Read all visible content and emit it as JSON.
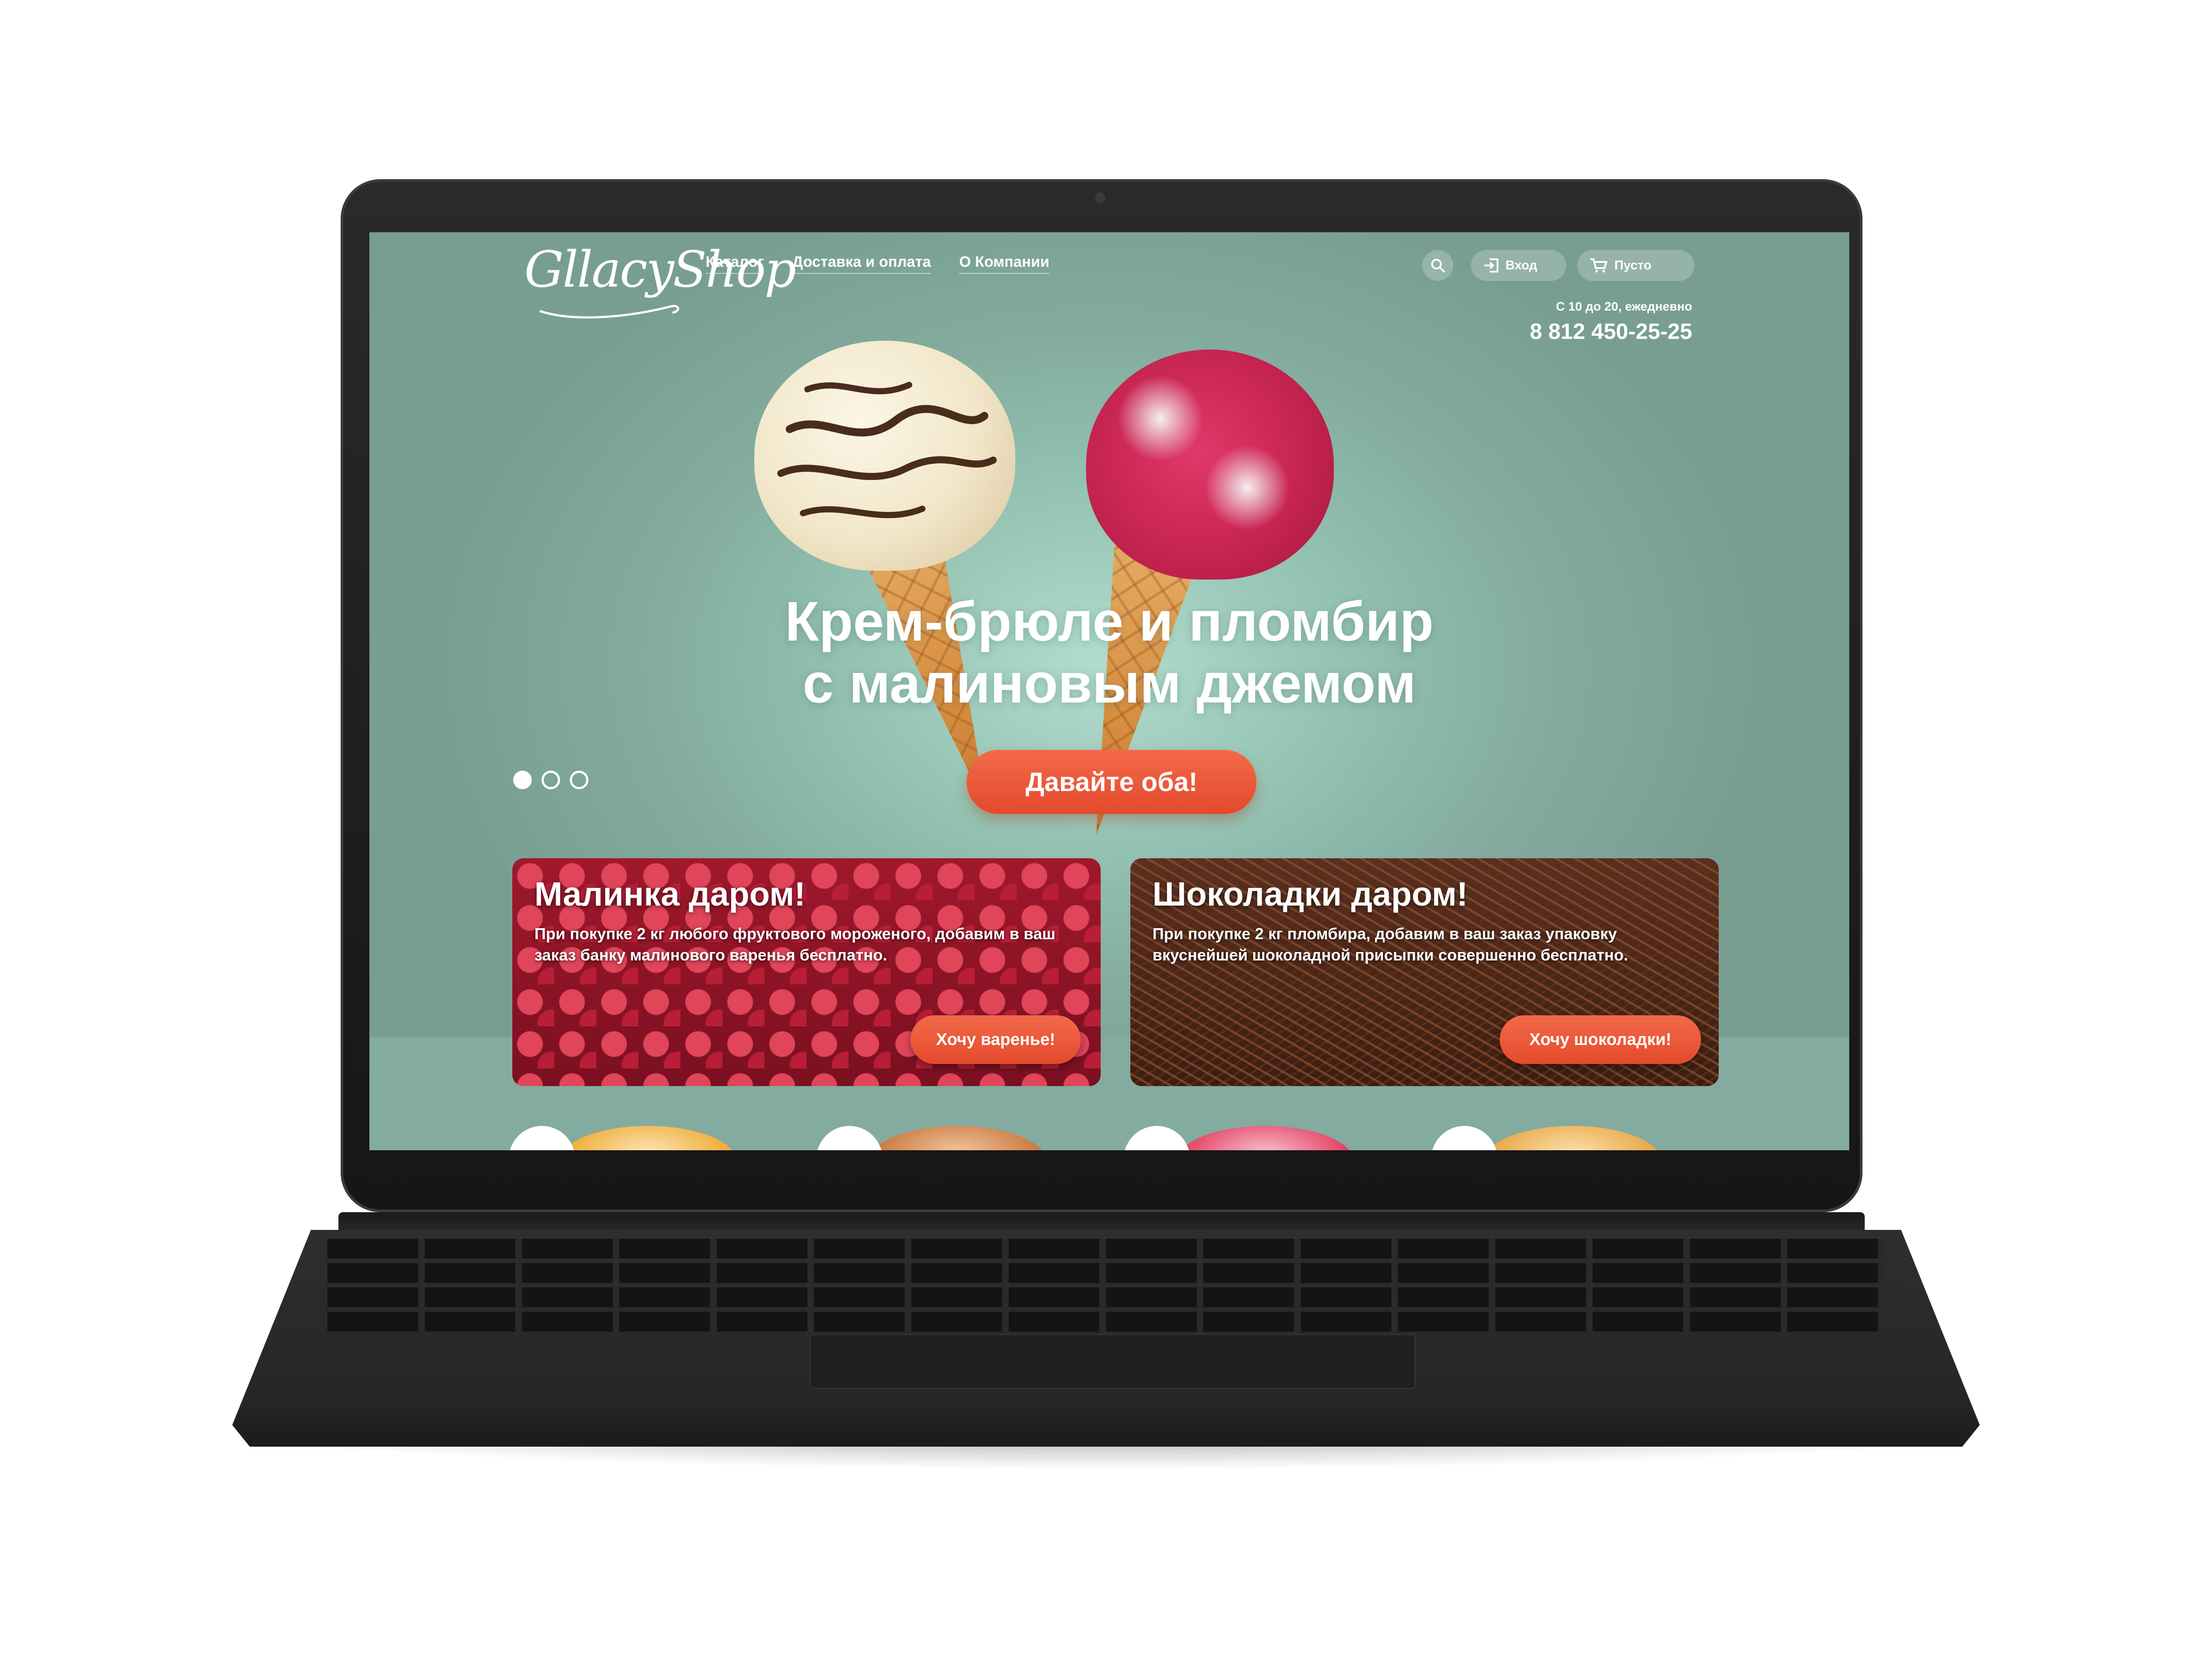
{
  "header": {
    "logo": "GllacyShop",
    "nav": [
      "Каталог",
      "Доставка и оплата",
      "О Компании"
    ],
    "login_label": "Вход",
    "cart_label": "Пусто",
    "hours": "С 10 до 20, ежедневно",
    "phone": "8 812 450-25-25"
  },
  "hero": {
    "title_line1": "Крем-брюле и пломбир",
    "title_line2": "с малиновым джемом",
    "cta": "Давайте оба!",
    "slides_total": 3,
    "active_slide": 1
  },
  "promos": [
    {
      "title": "Малинка даром!",
      "text": "При покупке 2 кг любого фруктового мороженого, добавим в ваш заказ банку малинового варенья бесплатно.",
      "button": "Хочу варенье!"
    },
    {
      "title": "Шоколадки даром!",
      "text": "При покупке 2 кг пломбира, добавим в ваш заказ упаковку вкуснейшей шоколадной присыпки совершенно бесплатно.",
      "button": "Хочу шоколадки!"
    }
  ],
  "icons": {
    "search": "search-icon",
    "login": "login-icon",
    "cart": "cart-icon"
  },
  "colors": {
    "accent": "#e84e2f",
    "hero_bg": "#84ab9f",
    "text": "#ffffff"
  }
}
